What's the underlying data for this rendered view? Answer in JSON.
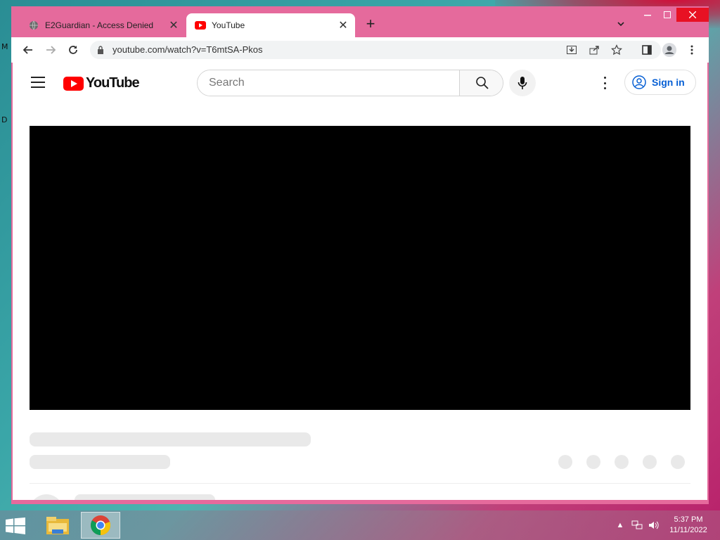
{
  "browser": {
    "tabs": [
      {
        "title": "E2Guardian - Access Denied",
        "active": false,
        "favicon": "globe-icon"
      },
      {
        "title": "YouTube",
        "active": true,
        "favicon": "youtube-icon"
      }
    ],
    "url": "youtube.com/watch?v=T6mtSA-Pkos",
    "frame_color": "#e56a9c"
  },
  "youtube": {
    "logo_text": "YouTube",
    "search_placeholder": "Search",
    "sign_in_label": "Sign in",
    "brand_color": "#ff0000",
    "link_color": "#065fd4"
  },
  "taskbar": {
    "time": "5:37 PM",
    "date": "11/11/2022",
    "apps": [
      "file-explorer-icon",
      "chrome-icon"
    ]
  },
  "desktop": {
    "edge_letters": [
      "M",
      "D"
    ]
  }
}
